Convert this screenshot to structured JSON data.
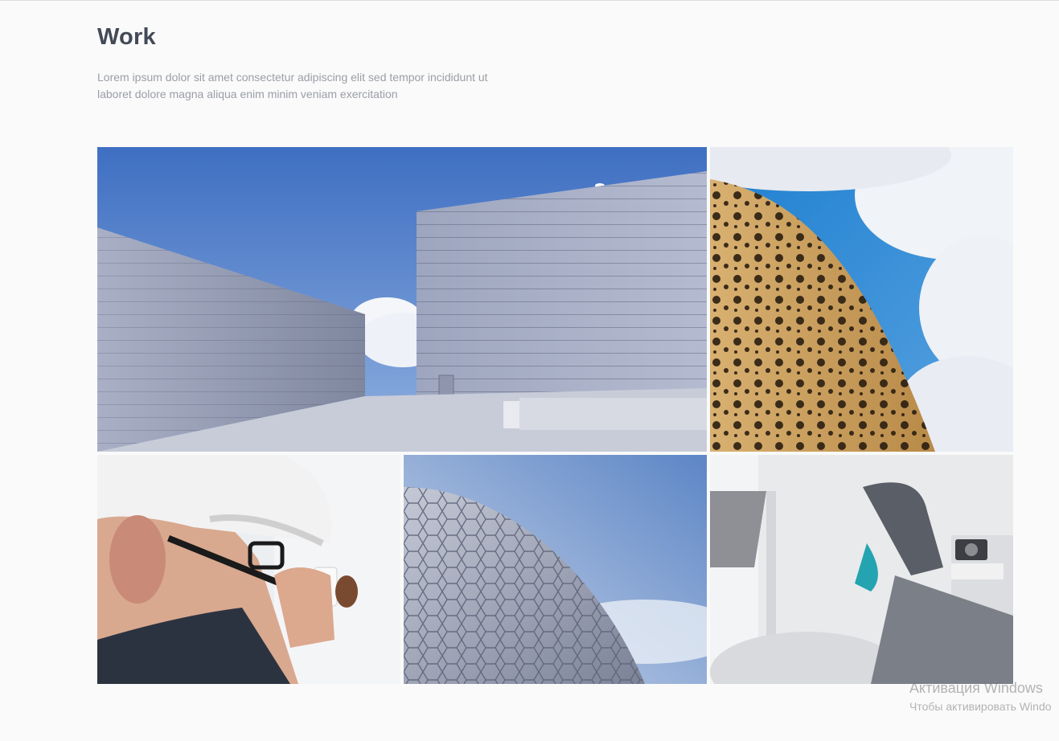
{
  "section": {
    "title": "Work",
    "description_line1": "Lorem ipsum dolor sit amet consectetur adipiscing elit sed tempor incididunt ut",
    "description_line2": "laboret dolore magna aliqua enim minim veniam exercitation"
  },
  "gallery": [
    {
      "id": "architecture-walls"
    },
    {
      "id": "perforated-tower"
    },
    {
      "id": "worker-hardhat"
    },
    {
      "id": "hexagon-dome"
    },
    {
      "id": "sneakers-chair"
    }
  ],
  "watermark": {
    "title": "Активация Windows",
    "subtitle": "Чтобы активировать Windo"
  },
  "colors": {
    "heading": "#434a57",
    "body_text": "#9a9ea6",
    "background": "#fafafa"
  }
}
